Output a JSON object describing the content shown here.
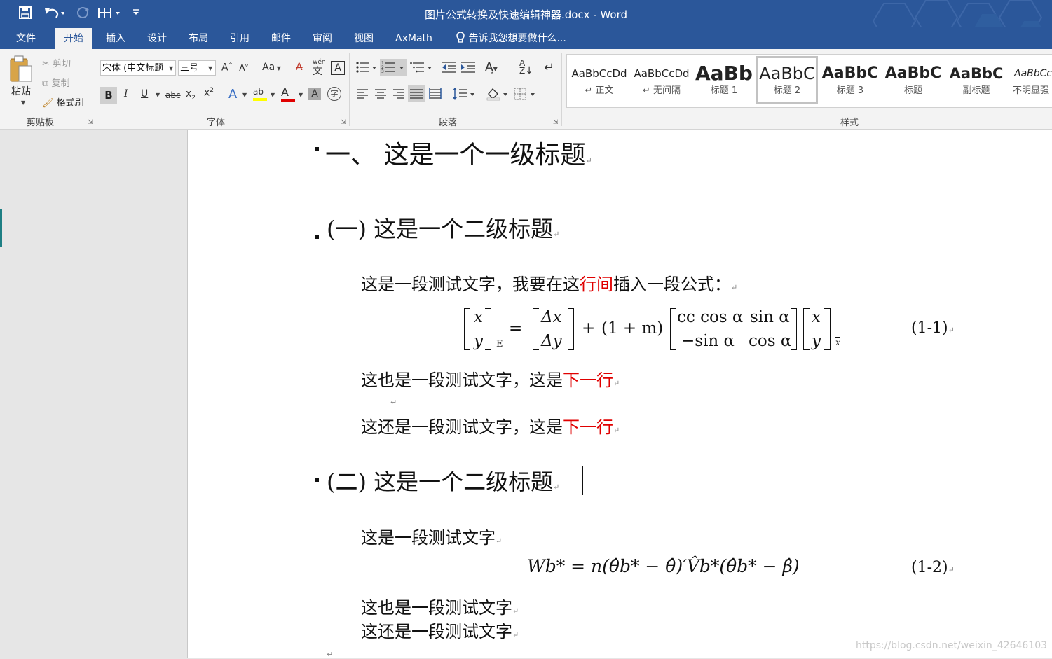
{
  "window": {
    "title": "图片公式转换及快速编辑神器.docx - Word",
    "accent_color": "#2b579a"
  },
  "quick_access": [
    {
      "name": "save-icon"
    },
    {
      "name": "undo-icon"
    },
    {
      "name": "redo-icon"
    },
    {
      "name": "touch-mode-icon"
    },
    {
      "name": "customize-qat-icon"
    }
  ],
  "tabs": [
    {
      "label": "文件"
    },
    {
      "label": "开始",
      "active": true
    },
    {
      "label": "插入"
    },
    {
      "label": "设计"
    },
    {
      "label": "布局"
    },
    {
      "label": "引用"
    },
    {
      "label": "邮件"
    },
    {
      "label": "审阅"
    },
    {
      "label": "视图"
    },
    {
      "label": "AxMath"
    }
  ],
  "tell_me": "告诉我您想要做什么...",
  "clipboard": {
    "paste": "粘贴",
    "cut": "剪切",
    "copy": "复制",
    "format_painter": "格式刷",
    "group": "剪贴板"
  },
  "font": {
    "name": "宋体 (中文标题",
    "size": "三号",
    "change_case": "Aa",
    "phonetic": "wén",
    "group": "字体"
  },
  "paragraph": {
    "group": "段落"
  },
  "styles": {
    "group": "样式",
    "items": [
      {
        "sample": "AaBbCcDd",
        "name": "正文"
      },
      {
        "sample": "AaBbCcDd",
        "name": "无间隔"
      },
      {
        "sample": "AaBb",
        "name": "标题 1"
      },
      {
        "sample": "AaBbC",
        "name": "标题 2",
        "selected": true
      },
      {
        "sample": "AaBbC",
        "name": "标题 3"
      },
      {
        "sample": "AaBbC",
        "name": "标题"
      },
      {
        "sample": "AaBbC",
        "name": "副标题"
      },
      {
        "sample": "AaBbCc",
        "name": "不明显强"
      }
    ]
  },
  "document": {
    "heading1": "一、 这是一个一级标题",
    "heading2a": "(一) 这是一个二级标题",
    "p1_before": "这是一段测试文字，我要在这",
    "p1_red": "行间",
    "p1_after": "插入一段公式：",
    "eq1": {
      "lhs_top": "x",
      "lhs_bottom": "y",
      "lhs_sub": "E",
      "rhs_top": "Δx",
      "rhs_bottom": "Δy",
      "plus": "+",
      "factor": "(1 + m)",
      "m11": "cc cos α",
      "m12": "sin α",
      "m21": "−sin α",
      "m22": "cos α",
      "v_top": "x",
      "v_bottom": "y",
      "v_sub": "x",
      "number": "(1-1)"
    },
    "p2_before": "这也是一段测试文字，这是",
    "p2_red": "下一行",
    "p3_before": "这还是一段测试文字，这是",
    "p3_red": "下一行",
    "heading2b": "(二) 这是一个二级标题",
    "p4": "这是一段测试文字",
    "eq2": {
      "text": "Wb* = n(θ̂b* − θ̂)′V̂b*(θ̂b* − β̂)",
      "number": "(1-2)"
    },
    "p5": "这也是一段测试文字",
    "p6": "这还是一段测试文字"
  },
  "watermark": "https://blog.csdn.net/weixin_42646103"
}
